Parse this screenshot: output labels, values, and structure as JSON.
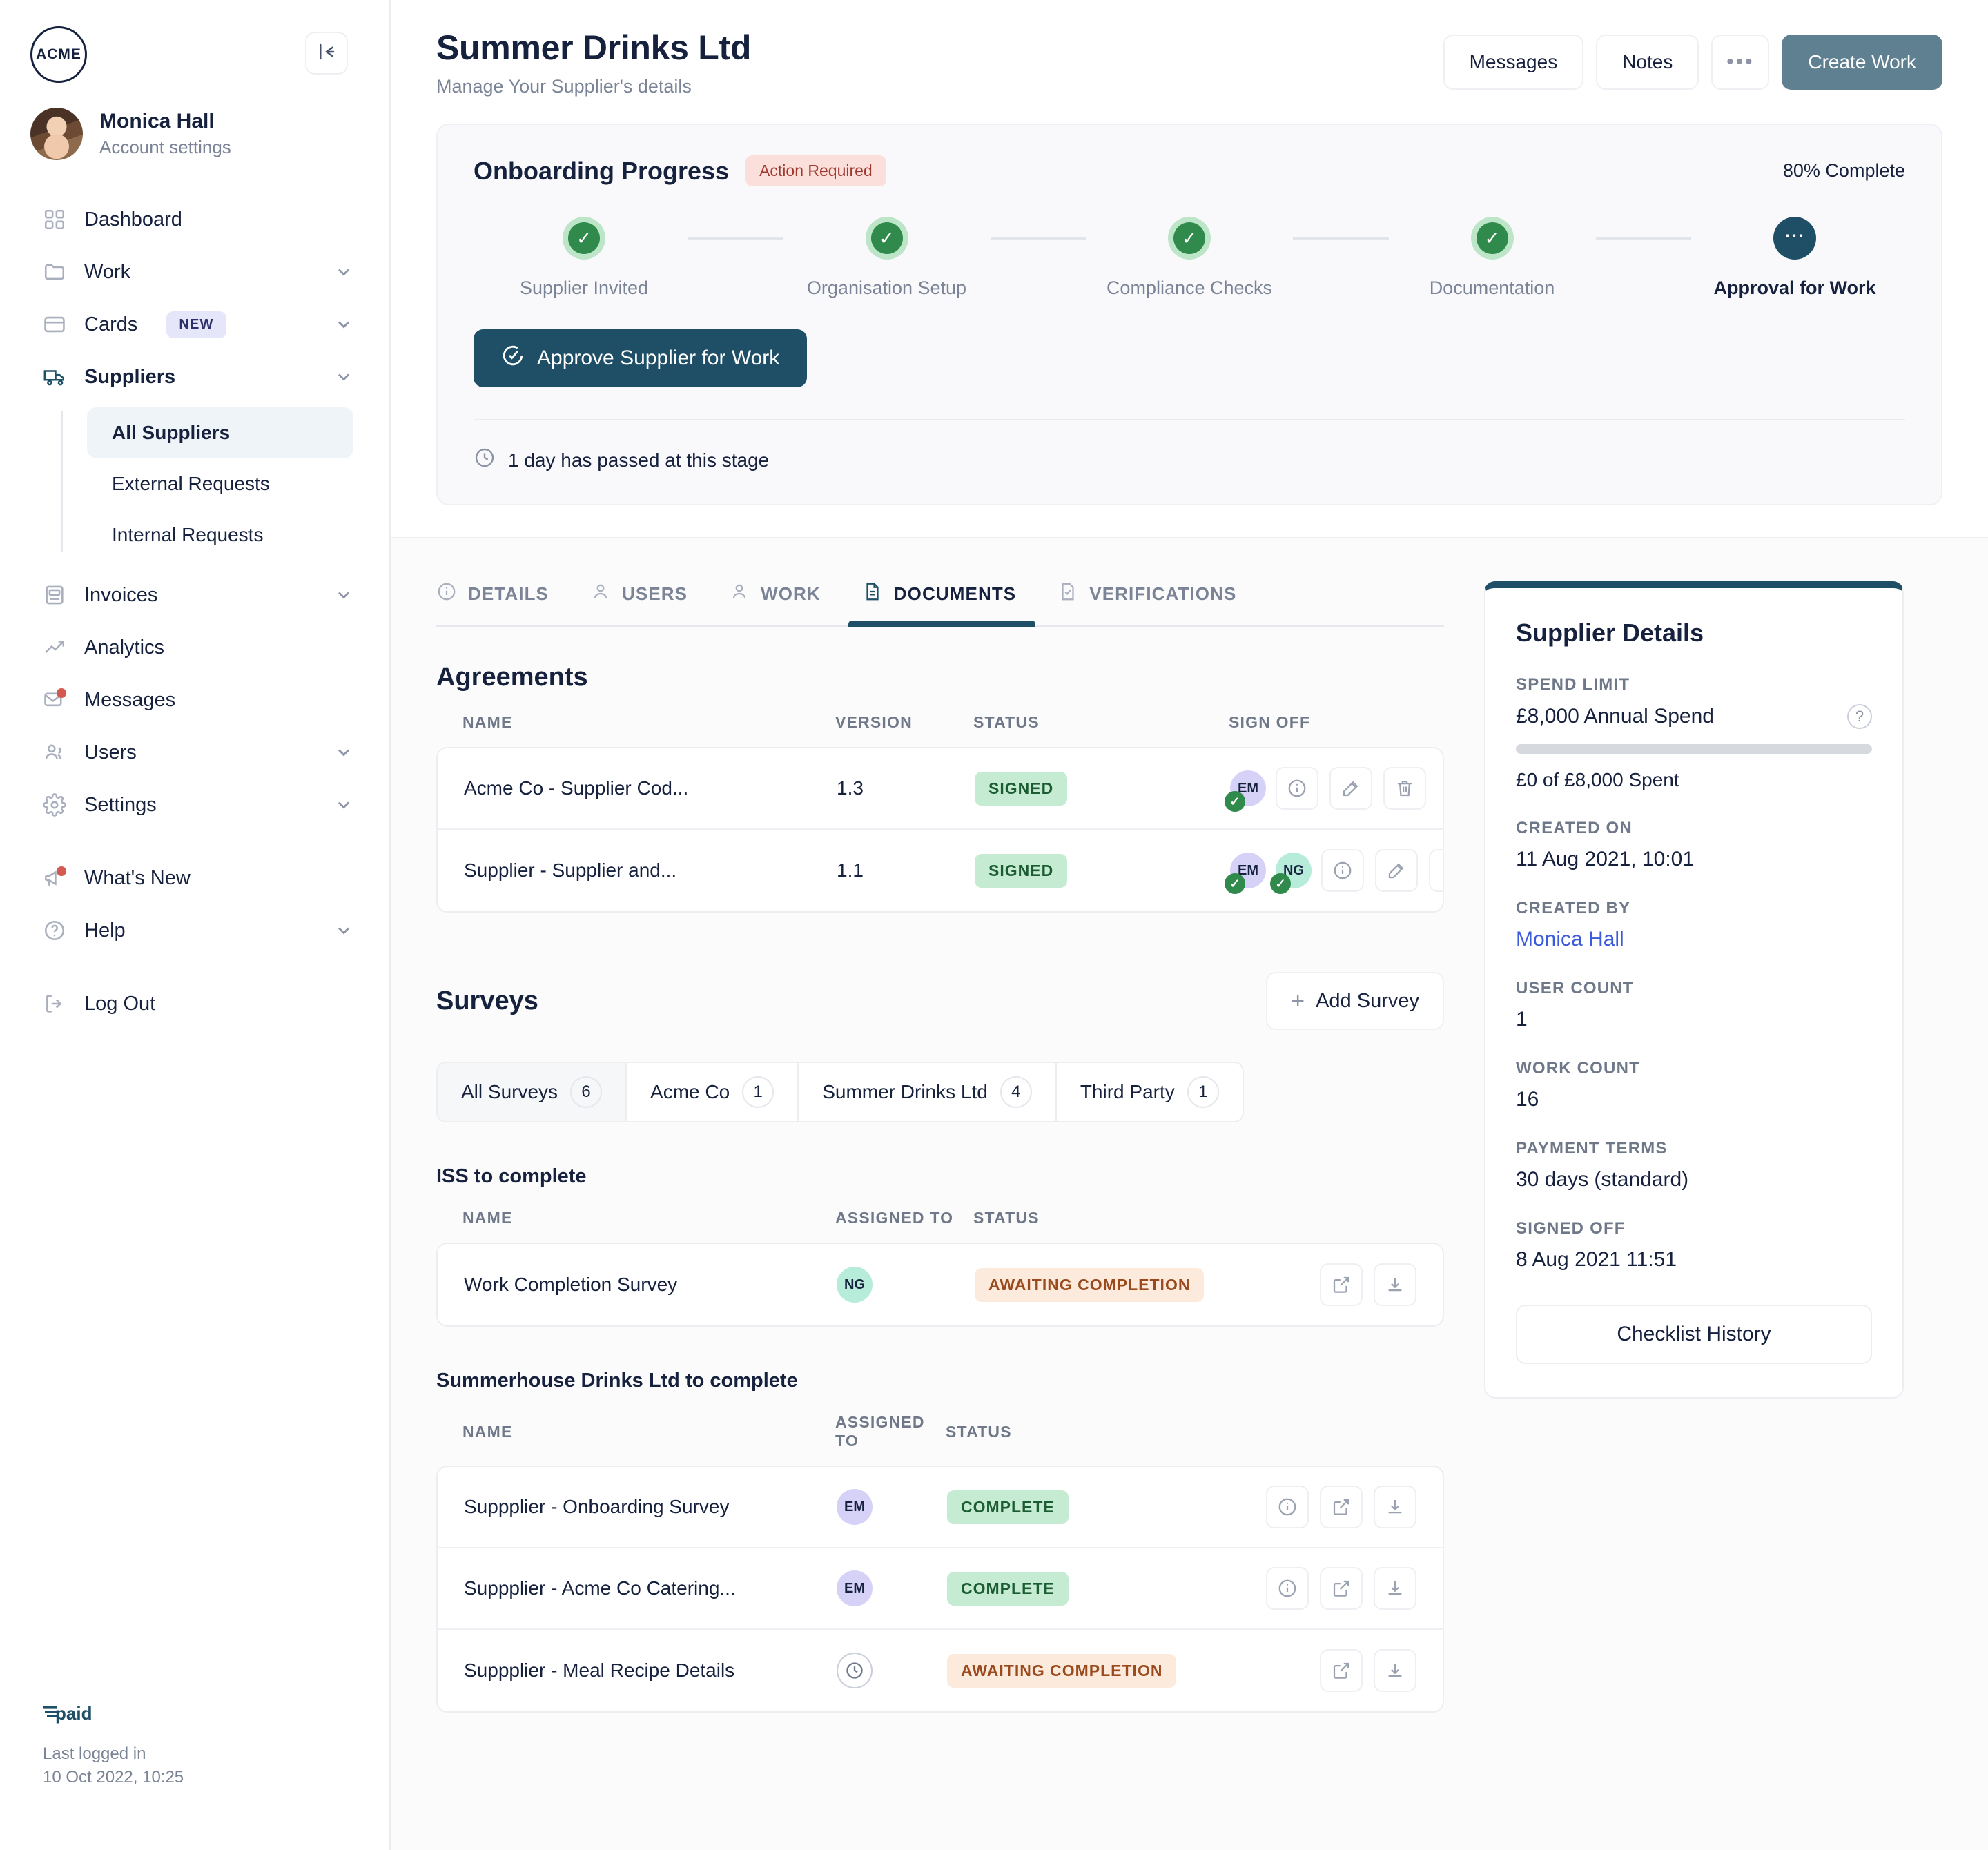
{
  "sidebar": {
    "logo_text": "ACME",
    "collapse_icon": "collapse-panel-icon",
    "profile": {
      "name": "Monica Hall",
      "subtitle": "Account settings"
    },
    "nav": [
      {
        "label": "Dashboard",
        "icon": "grid-icon",
        "chevron": false
      },
      {
        "label": "Work",
        "icon": "folder-icon",
        "chevron": true
      },
      {
        "label": "Cards",
        "icon": "card-icon",
        "chevron": true,
        "badge": "NEW"
      },
      {
        "label": "Suppliers",
        "icon": "truck-icon",
        "chevron": true,
        "active": true
      },
      {
        "label": "Invoices",
        "icon": "invoice-icon",
        "chevron": true
      },
      {
        "label": "Analytics",
        "icon": "trend-icon",
        "chevron": false
      },
      {
        "label": "Messages",
        "icon": "mail-icon",
        "chevron": false,
        "dot": true
      },
      {
        "label": "Users",
        "icon": "users-icon",
        "chevron": true
      },
      {
        "label": "Settings",
        "icon": "gear-icon",
        "chevron": true
      },
      {
        "label": "What's New",
        "icon": "megaphone-icon",
        "chevron": false,
        "dot": true
      },
      {
        "label": "Help",
        "icon": "help-circle-icon",
        "chevron": true
      },
      {
        "label": "Log Out",
        "icon": "logout-icon",
        "chevron": false
      }
    ],
    "subnav": [
      {
        "label": "All Suppliers",
        "active": true
      },
      {
        "label": "External Requests",
        "active": false
      },
      {
        "label": "Internal Requests",
        "active": false
      }
    ],
    "footer": {
      "brand": "paid",
      "last_logged_label": "Last logged in",
      "last_logged_value": "10 Oct 2022, 10:25"
    }
  },
  "header": {
    "title": "Summer Drinks Ltd",
    "subtitle": "Manage Your Supplier's details",
    "messages_label": "Messages",
    "notes_label": "Notes",
    "more_label": "•••",
    "create_work_label": "Create Work"
  },
  "onboarding": {
    "title": "Onboarding Progress",
    "status_badge": "Action Required",
    "percent_label": "80% Complete",
    "steps": [
      {
        "label": "Supplier Invited",
        "state": "complete"
      },
      {
        "label": "Organisation Setup",
        "state": "complete"
      },
      {
        "label": "Compliance Checks",
        "state": "complete"
      },
      {
        "label": "Documentation",
        "state": "complete"
      },
      {
        "label": "Approval for Work",
        "state": "current"
      }
    ],
    "approve_button": "Approve Supplier for Work",
    "footer_note": "1 day has passed at this stage"
  },
  "tabs": [
    {
      "label": "DETAILS",
      "icon": "info-circle-icon",
      "active": false
    },
    {
      "label": "USERS",
      "icon": "user-icon",
      "active": false
    },
    {
      "label": "WORK",
      "icon": "user-icon",
      "active": false
    },
    {
      "label": "DOCUMENTS",
      "icon": "document-icon",
      "active": true
    },
    {
      "label": "VERIFICATIONS",
      "icon": "document-check-icon",
      "active": false
    }
  ],
  "agreements": {
    "title": "Agreements",
    "columns": [
      "NAME",
      "VERSION",
      "STATUS",
      "SIGN OFF"
    ],
    "rows": [
      {
        "name": "Acme Co - Supplier Cod...",
        "version": "1.3",
        "status": "SIGNED",
        "signers": [
          {
            "initials": "EM",
            "color": "purple",
            "signed": true
          }
        ]
      },
      {
        "name": "Supplier - Supplier and...",
        "version": "1.1",
        "status": "SIGNED",
        "signers": [
          {
            "initials": "EM",
            "color": "purple",
            "signed": true
          },
          {
            "initials": "NG",
            "color": "green",
            "signed": true
          }
        ]
      }
    ]
  },
  "surveys": {
    "title": "Surveys",
    "add_button": "Add Survey",
    "filters": [
      {
        "label": "All Surveys",
        "count": "6",
        "active": true
      },
      {
        "label": "Acme Co",
        "count": "1",
        "active": false
      },
      {
        "label": "Summer Drinks Ltd",
        "count": "4",
        "active": false
      },
      {
        "label": "Third Party",
        "count": "1",
        "active": false
      }
    ],
    "columns": [
      "NAME",
      "ASSIGNED TO",
      "STATUS"
    ],
    "groups": [
      {
        "heading": "ISS to complete",
        "rows": [
          {
            "name": "Work Completion Survey",
            "assigned": {
              "initials": "NG",
              "color": "green"
            },
            "status": "AWAITING COMPLETION",
            "status_kind": "awaiting",
            "actions": [
              "open-external-icon",
              "download-icon"
            ]
          }
        ]
      },
      {
        "heading": "Summerhouse Drinks Ltd to complete",
        "rows": [
          {
            "name": "Suppplier - Onboarding Survey",
            "assigned": {
              "initials": "EM",
              "color": "purple"
            },
            "status": "COMPLETE",
            "status_kind": "complete",
            "actions": [
              "info-icon",
              "open-external-icon",
              "download-icon"
            ]
          },
          {
            "name": "Suppplier - Acme Co Catering...",
            "assigned": {
              "initials": "EM",
              "color": "purple"
            },
            "status": "COMPLETE",
            "status_kind": "complete",
            "actions": [
              "info-icon",
              "open-external-icon",
              "download-icon"
            ]
          },
          {
            "name": "Suppplier - Meal Recipe Details",
            "assigned": {
              "initials": "",
              "color": "clock"
            },
            "status": "AWAITING COMPLETION",
            "status_kind": "awaiting",
            "actions": [
              "open-external-icon",
              "download-icon"
            ]
          }
        ]
      }
    ]
  },
  "supplier_details": {
    "title": "Supplier Details",
    "spend_limit_label": "SPEND LIMIT",
    "spend_limit_value": "£8,000 Annual Spend",
    "spend_progress_text": "£0 of £8,000 Spent",
    "created_on_label": "CREATED ON",
    "created_on_value": "11 Aug 2021, 10:01",
    "created_by_label": "CREATED BY",
    "created_by_value": "Monica Hall",
    "user_count_label": "USER COUNT",
    "user_count_value": "1",
    "work_count_label": "WORK COUNT",
    "work_count_value": "16",
    "payment_terms_label": "PAYMENT TERMS",
    "payment_terms_value": "30 days (standard)",
    "signed_off_label": "SIGNED OFF",
    "signed_off_value": "8 Aug 2021 11:51",
    "checklist_button": "Checklist History"
  },
  "colors": {
    "accent_dark": "#1f4f66",
    "primary_button": "#5f8090",
    "success": "#2f8a4c",
    "danger": "#a03a30",
    "warning": "#9a4a1c",
    "link": "#3b5bdb"
  }
}
